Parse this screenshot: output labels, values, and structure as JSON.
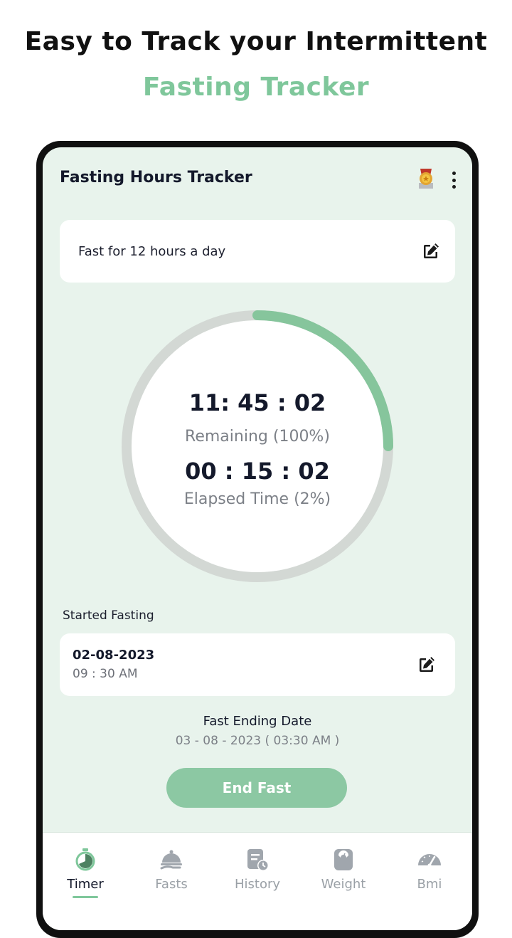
{
  "promo": {
    "line1": "Easy to Track your Intermittent",
    "line2": "Fasting Tracker"
  },
  "header": {
    "title": "Fasting Hours Tracker",
    "icons": [
      "medal-icon",
      "more-vert-icon"
    ]
  },
  "plan": {
    "text": "Fast for 12 hours a day",
    "icon": "edit-icon"
  },
  "timer": {
    "remaining_time": "11: 45 : 02",
    "remaining_label": "Remaining (100%)",
    "elapsed_time": "00 : 15 : 02",
    "elapsed_label": "Elapsed Time (2%)",
    "progress_fraction": 0.25
  },
  "start": {
    "section_label": "Started Fasting",
    "date": "02-08-2023",
    "time": "09 : 30 AM",
    "icon": "edit-icon"
  },
  "end": {
    "label": "Fast Ending Date",
    "value": "03 - 08 - 2023 ( 03:30 AM )",
    "button": "End Fast"
  },
  "nav": {
    "items": [
      {
        "label": "Timer",
        "icon": "stopwatch-icon",
        "active": true
      },
      {
        "label": "Fasts",
        "icon": "cloche-icon",
        "active": false
      },
      {
        "label": "History",
        "icon": "history-icon",
        "active": false
      },
      {
        "label": "Weight",
        "icon": "scale-icon",
        "active": false
      },
      {
        "label": "Bmi",
        "icon": "gauge-icon",
        "active": false
      }
    ]
  },
  "colors": {
    "accent": "#7fc79b",
    "screen_bg": "#e8f3ec",
    "ring_track": "#d3d8d4",
    "ring_progress": "#86c59c",
    "button": "#8cc8a3"
  }
}
